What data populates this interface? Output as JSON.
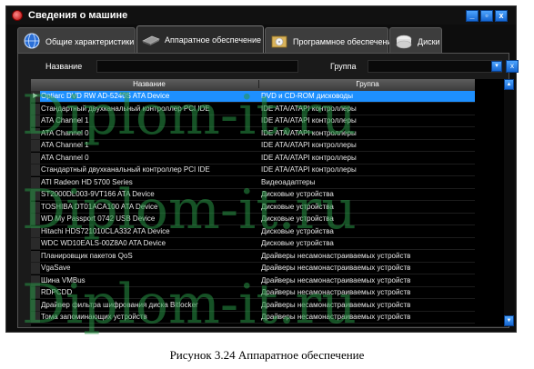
{
  "window": {
    "title": "Сведения о машине",
    "buttons": [
      "_",
      "▫",
      "x"
    ]
  },
  "tabs": [
    {
      "label": "Общие характеристики",
      "icon": "globe-icon",
      "active": false
    },
    {
      "label": "Аппаратное обеспечение",
      "icon": "hardware-drive-icon",
      "active": true
    },
    {
      "label": "Программное обеспечение",
      "icon": "software-box-icon",
      "active": false
    },
    {
      "label": "Диски",
      "icon": "disk-icon",
      "active": false
    }
  ],
  "filters": {
    "name_label": "Название",
    "name_value": "",
    "group_label": "Группа",
    "group_value": "",
    "dropdown_arrow": "▾",
    "clear_label": "x"
  },
  "table": {
    "columns": [
      "Название",
      "Группа"
    ],
    "selected_index": 0,
    "rows": [
      [
        "Optiarc DVD RW AD-5240S ATA Device",
        "DVD и CD-ROM дисководы"
      ],
      [
        "Стандартный двухканальный контроллер PCI IDE",
        "IDE ATA/ATAPI контроллеры"
      ],
      [
        "ATA Channel 1",
        "IDE ATA/ATAPI контроллеры"
      ],
      [
        "ATA Channel 0",
        "IDE ATA/ATAPI контроллеры"
      ],
      [
        "ATA Channel 1",
        "IDE ATA/ATAPI контроллеры"
      ],
      [
        "ATA Channel 0",
        "IDE ATA/ATAPI контроллеры"
      ],
      [
        "Стандартный двухканальный контроллер PCI IDE",
        "IDE ATA/ATAPI контроллеры"
      ],
      [
        "ATI Radeon HD 5700 Series",
        "Видеоадаптеры"
      ],
      [
        "ST2000DL003-9VT166 ATA Device",
        "Дисковые устройства"
      ],
      [
        "TOSHIBA DT01ACA100 ATA Device",
        "Дисковые устройства"
      ],
      [
        "WD My Passport 0742 USB Device",
        "Дисковые устройства"
      ],
      [
        "Hitachi HDS721010CLA332 ATA Device",
        "Дисковые устройства"
      ],
      [
        "WDC WD10EALS-00Z8A0 ATA Device",
        "Дисковые устройства"
      ],
      [
        "Планировщик пакетов QoS",
        "Драйверы несамонастраиваемых устройств"
      ],
      [
        "VgaSave",
        "Драйверы несамонастраиваемых устройств"
      ],
      [
        "Шина VMBus",
        "Драйверы несамонастраиваемых устройств"
      ],
      [
        "RDPCDD",
        "Драйверы несамонастраиваемых устройств"
      ],
      [
        "Драйвер фильтра шифрования диска Bitlocker",
        "Драйверы несамонастраиваемых устройств"
      ],
      [
        "Тома запоминающих устройств",
        "Драйверы несамонастраиваемых устройств"
      ]
    ],
    "selected_marker": "▶"
  },
  "scrollbar": {
    "up": "▲",
    "down": "▼"
  },
  "watermark": "Diplom-it.ru",
  "caption": "Рисунок 3.24 Аппаратное обеспечение",
  "colors": {
    "selection": "#1e90ff",
    "window_bg": "#0d0d0d",
    "accent": "#1566d1",
    "watermark": "#2d9646"
  }
}
